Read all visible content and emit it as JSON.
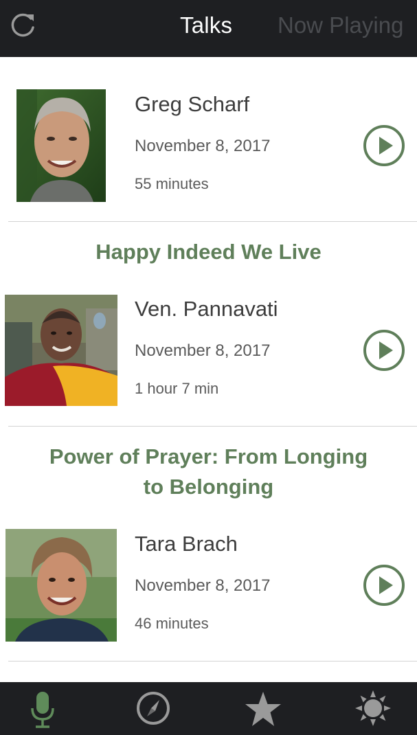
{
  "header": {
    "tabs": [
      {
        "label": "Talks",
        "active": true
      },
      {
        "label": "Now Playing",
        "active": false
      }
    ],
    "refresh_icon": "refresh-icon"
  },
  "talks": [
    {
      "title": "",
      "speaker": "Greg Scharf",
      "date": "November 8, 2017",
      "duration": "55 minutes"
    },
    {
      "title": "Happy Indeed We Live",
      "speaker": "Ven. Pannavati",
      "date": "November 8, 2017",
      "duration": "1 hour 7 min"
    },
    {
      "title": "Power of Prayer: From Longing to Belonging",
      "title_lines": [
        "Power of Prayer: From Longing",
        "to Belonging"
      ],
      "speaker": "Tara Brach",
      "date": "November 8, 2017",
      "duration": "46 minutes"
    }
  ],
  "tabbar": {
    "icons": [
      "microphone-icon",
      "compass-icon",
      "star-icon",
      "sun-icon"
    ],
    "active_index": 0
  },
  "colors": {
    "accent": "#5f7f5a",
    "header_bg": "#1e1f22",
    "inactive_tab": "#4a4c50"
  }
}
